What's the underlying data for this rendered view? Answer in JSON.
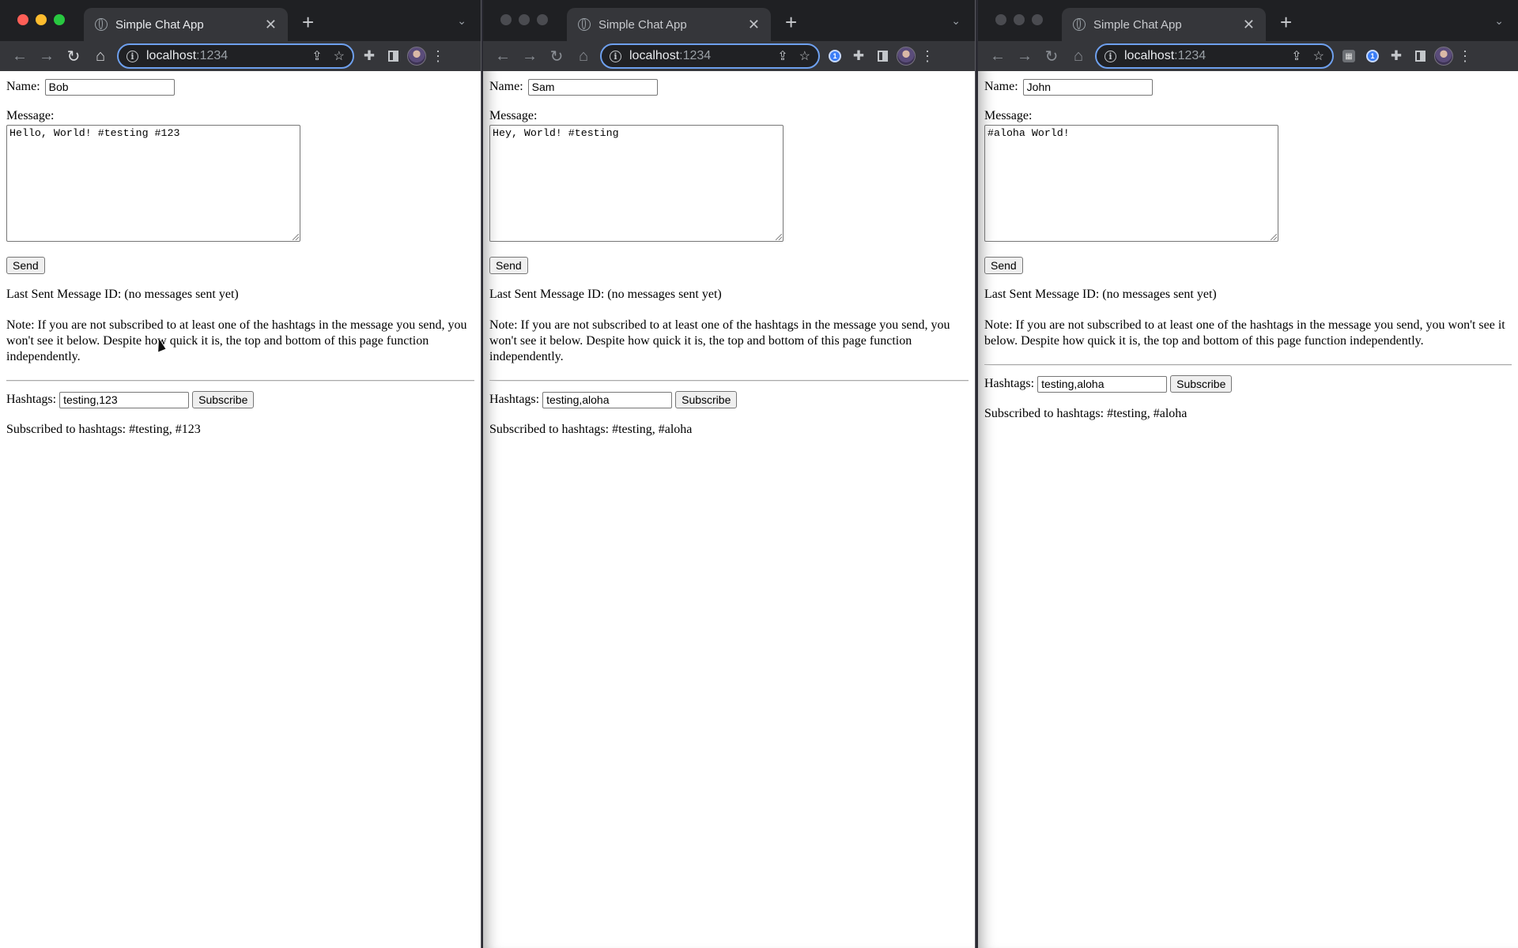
{
  "colors": {
    "titlebar": "#1f2023",
    "toolbar": "#35363a",
    "omnibox_focus": "#6ea0ee",
    "traffic_close": "#ff5f57",
    "traffic_min": "#febc2e",
    "traffic_max": "#28c840"
  },
  "windows": [
    {
      "tab_title": "Simple Chat App",
      "url_host": "localhost",
      "url_port": ":1234",
      "name_label": "Name:",
      "name_value": "Bob",
      "message_label": "Message:",
      "message_value": "Hello, World! #testing #123",
      "send_label": "Send",
      "last_sent": "Last Sent Message ID: (no messages sent yet)",
      "note": "Note: If you are not subscribed to at least one of the hashtags in the message you send, you won't see it below. Despite how quick it is, the top and bottom of this page function independently.",
      "hashtags_label": "Hashtags:",
      "hashtags_value": "testing,123",
      "subscribe_label": "Subscribe",
      "subscribed_text": "Subscribed to hashtags: #testing, #123"
    },
    {
      "tab_title": "Simple Chat App",
      "url_host": "localhost",
      "url_port": ":1234",
      "name_label": "Name:",
      "name_value": "Sam",
      "message_label": "Message:",
      "message_value": "Hey, World! #testing",
      "send_label": "Send",
      "last_sent": "Last Sent Message ID: (no messages sent yet)",
      "note": "Note: If you are not subscribed to at least one of the hashtags in the message you send, you won't see it below. Despite how quick it is, the top and bottom of this page function independently.",
      "hashtags_label": "Hashtags:",
      "hashtags_value": "testing,aloha",
      "subscribe_label": "Subscribe",
      "subscribed_text": "Subscribed to hashtags: #testing, #aloha"
    },
    {
      "tab_title": "Simple Chat App",
      "url_host": "localhost",
      "url_port": ":1234",
      "name_label": "Name:",
      "name_value": "John",
      "message_label": "Message:",
      "message_value": "#aloha World!",
      "send_label": "Send",
      "last_sent": "Last Sent Message ID: (no messages sent yet)",
      "note": "Note: If you are not subscribed to at least one of the hashtags in the message you send, you won't see it below. Despite how quick it is, the top and bottom of this page function independently.",
      "hashtags_label": "Hashtags:",
      "hashtags_value": "testing,aloha",
      "subscribe_label": "Subscribe",
      "subscribed_text": "Subscribed to hashtags: #testing, #aloha"
    }
  ]
}
